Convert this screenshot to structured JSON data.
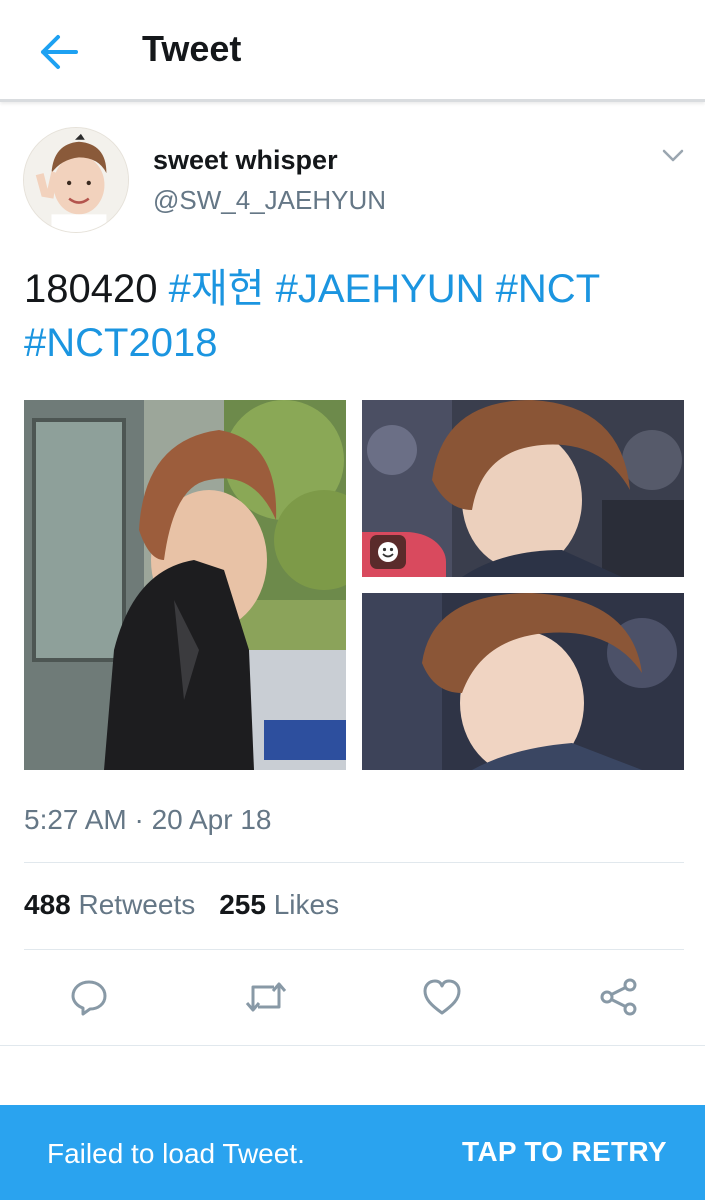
{
  "header": {
    "title": "Tweet",
    "back_icon": "arrow-left-icon",
    "accent_color": "#1da1f2"
  },
  "tweet": {
    "author": {
      "display_name": "sweet whisper",
      "handle": "@SW_4_JAEHYUN"
    },
    "text_prefix": "180420",
    "hashtags": [
      "#재현",
      "#JAEHYUN",
      "#NCT",
      "#NCT2018"
    ],
    "hashtag_color": "#1b95e0",
    "timestamp": "5:27 AM · 20 Apr 18",
    "stats": {
      "retweets_count": "488",
      "retweets_label": "Retweets",
      "likes_count": "255",
      "likes_label": "Likes"
    },
    "photos": [
      "photo-profile-leather-jacket",
      "photo-closeup-side-profile",
      "photo-closeup-side-profile-2"
    ],
    "actions": [
      "reply-icon",
      "retweet-icon",
      "like-icon",
      "share-icon"
    ]
  },
  "error_bar": {
    "message": "Failed to load Tweet.",
    "retry_label": "TAP TO RETRY",
    "background": "#2aa3ef"
  }
}
